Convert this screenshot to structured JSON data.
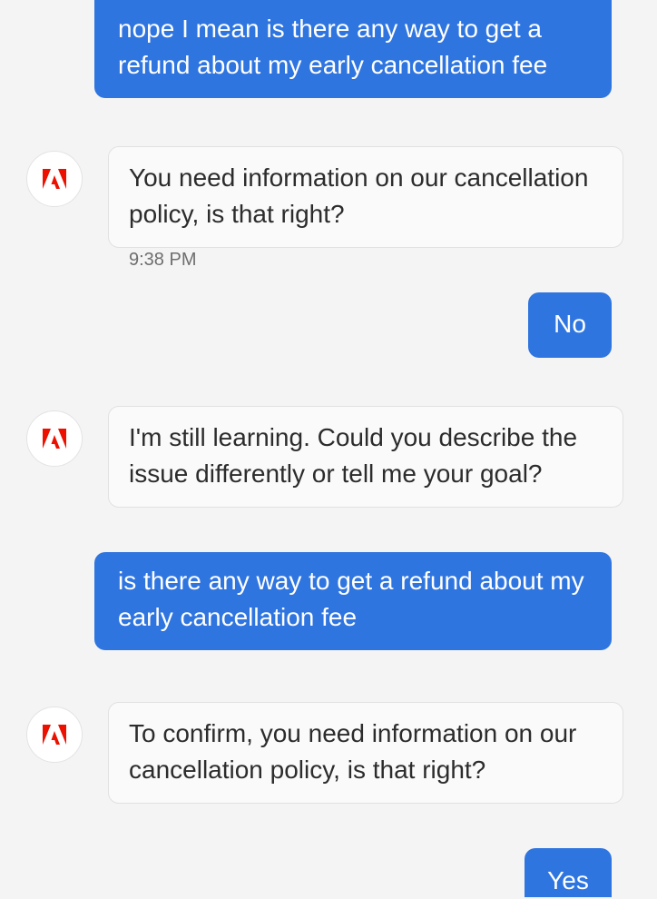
{
  "brand": {
    "accent": "#2f75e0",
    "logo_color": "#eb1000",
    "logo_icon": "adobe-logo-icon"
  },
  "messages": [
    {
      "sender": "user",
      "text": "nope I mean is there any way to get a refund about my early cancellation fee"
    },
    {
      "sender": "bot",
      "text": "You need information on our cancellation policy, is that right?",
      "time": "9:38 PM"
    },
    {
      "sender": "user",
      "text": "No"
    },
    {
      "sender": "bot",
      "text": "I'm still learning. Could you describe the issue differently or tell me your goal?"
    },
    {
      "sender": "user",
      "text": "is there any way to get a refund about my early cancellation fee"
    },
    {
      "sender": "bot",
      "text": "To confirm, you need information on our cancellation policy, is that right?"
    },
    {
      "sender": "user",
      "text": "Yes"
    }
  ]
}
